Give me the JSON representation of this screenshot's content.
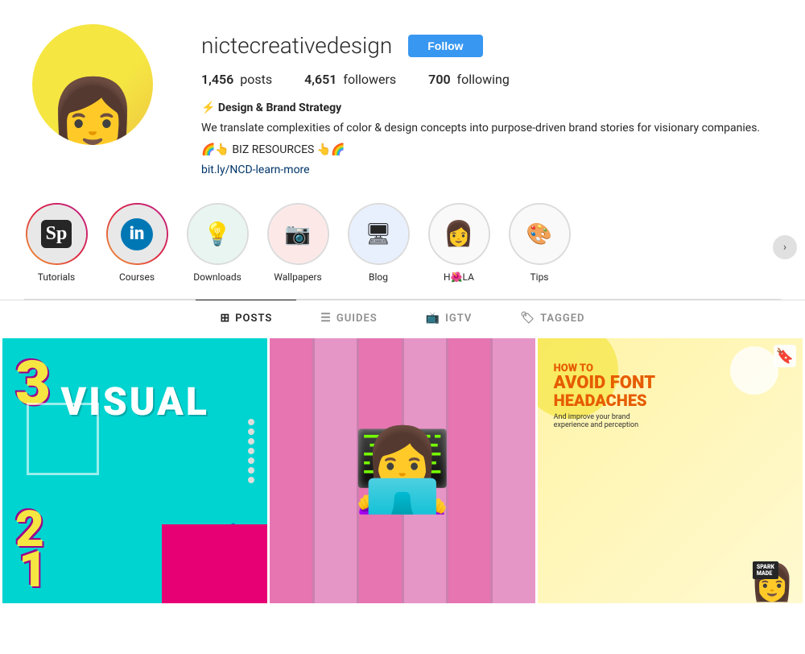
{
  "profile": {
    "username": "nictecreativedesign",
    "follow_label": "Follow",
    "stats": {
      "posts_count": "1,456",
      "posts_label": "posts",
      "followers_count": "4,651",
      "followers_label": "followers",
      "following_count": "700",
      "following_label": "following"
    },
    "bio": {
      "lightning": "⚡",
      "name": "Design & Brand Strategy",
      "text": "We translate complexities of color & design concepts into purpose-driven brand stories for visionary companies.",
      "biz_label": "🌈👆 BIZ RESOURCES 👆🌈",
      "link_text": "bit.ly/NCD-learn-more",
      "link_href": "http://bit.ly/NCD-learn-more"
    }
  },
  "highlights": [
    {
      "id": "tutorials",
      "label": "Tutorials",
      "icon_type": "sp",
      "border": "gradient"
    },
    {
      "id": "courses",
      "label": "Courses",
      "icon_type": "in",
      "border": "gradient"
    },
    {
      "id": "downloads",
      "label": "Downloads",
      "icon_type": "bulb",
      "border": "plain"
    },
    {
      "id": "wallpapers",
      "label": "Wallpapers",
      "icon_type": "camera",
      "border": "plain"
    },
    {
      "id": "blog",
      "label": "Blog",
      "icon_type": "monitor",
      "border": "plain"
    },
    {
      "id": "hola",
      "label": "H🌺LA",
      "icon_type": "person",
      "border": "plain"
    },
    {
      "id": "tips",
      "label": "Tips",
      "icon_type": "palette",
      "border": "plain"
    }
  ],
  "tabs": [
    {
      "id": "posts",
      "label": "POSTS",
      "icon": "⊞",
      "active": true
    },
    {
      "id": "guides",
      "label": "GUIDES",
      "icon": "🗂",
      "active": false
    },
    {
      "id": "igtv",
      "label": "IGTV",
      "icon": "📺",
      "active": false
    },
    {
      "id": "tagged",
      "label": "TAGGED",
      "icon": "🏷",
      "active": false
    }
  ],
  "posts": [
    {
      "id": "post1",
      "type": "visual_numbers",
      "title": "VISUAL",
      "numbers": "3 2 1",
      "bg_color": "#00d4d0"
    },
    {
      "id": "post2",
      "type": "person_photo",
      "bg_color": "#cc80b0"
    },
    {
      "id": "post3",
      "type": "font_headaches",
      "title": "HOW TO AVOID FONT HEADACHES",
      "subtitle": "And improve your brand experience and perception",
      "bg_color": "#f5f0a0",
      "has_save": true
    }
  ],
  "colors": {
    "follow_btn": "#3897f0",
    "active_tab_border": "#262626",
    "link_color": "#003569"
  }
}
